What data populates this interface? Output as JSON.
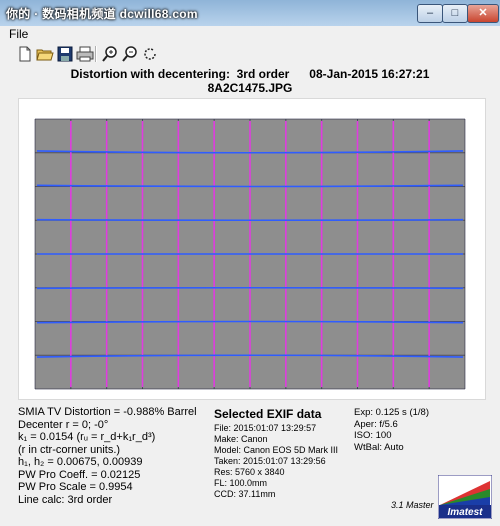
{
  "window": {
    "title": "你的 · 数码相机频道 dcwill68.com",
    "minimize_glyph": "–",
    "maximize_glyph": "□",
    "close_glyph": "✕"
  },
  "menu": {
    "file_label": "File"
  },
  "toolbar": {
    "icons": [
      "new-document-icon",
      "open-folder-icon",
      "save-disk-icon",
      "print-icon",
      "zoom-in-icon",
      "zoom-out-icon",
      "refresh-icon"
    ]
  },
  "header": {
    "title_line": "Distortion with decentering:  3rd order      08-Jan-2015 16:27:21",
    "filename": "8A2C1475.JPG"
  },
  "plot": {
    "blue_line_count": 7,
    "magenta_line_count": 11,
    "colors": {
      "blue": "#2f5dff",
      "magenta": "#e03ce0",
      "dark": "#1a1a3a",
      "photo": "#8c8c8c"
    }
  },
  "stats": {
    "tv_distortion": "SMIA TV Distortion = -0.988% Barrel",
    "decenter": "Decenter r = 0; -0°",
    "k1_eq": "k₁ = 0.0154  (rᵤ = r_d+k₁r_d³)",
    "units_note": "(r in ctr-corner units.)",
    "h_values": "h₁, h₂ = 0.00675, 0.00939",
    "pw_coeff": "PW Pro Coeff. = 0.02125",
    "pw_scale": "PW Pro Scale = 0.9954",
    "line_calc": "Line calc: 3rd order"
  },
  "exif": {
    "title": "Selected EXIF data",
    "file": "File:  2015:01:07  13:29:57",
    "make": "Make:  Canon",
    "model": "Model: Canon EOS 5D Mark III",
    "taken": "Taken: 2015:01:07  13:29:56",
    "res": "Res:    5760 x 3840",
    "fl": "FL:   100.0mm",
    "ccd": "CCD:    37.11mm"
  },
  "exposure": {
    "exp": "Exp:   0.125 s  (1/8)",
    "aper": "Aper:  f/5.6",
    "iso": "ISO:   100",
    "wtbal": "WtBal:  Auto"
  },
  "footer": {
    "version": "3.1  Master",
    "logo_text": "Imatest"
  }
}
